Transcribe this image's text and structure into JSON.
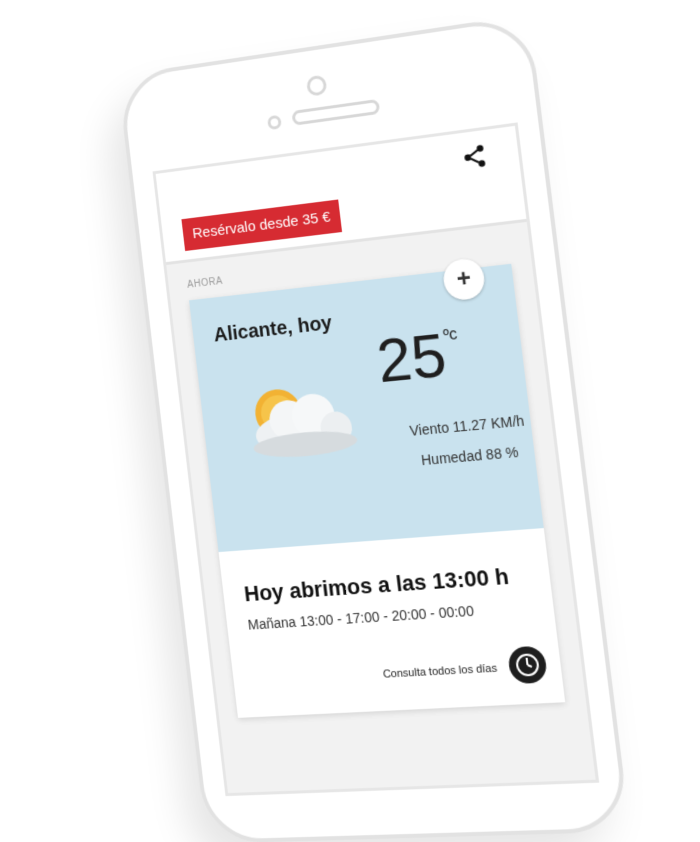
{
  "topbar": {
    "reserve_label": "Resérvalo desde 35 €",
    "share_icon": "share-icon"
  },
  "now_section": {
    "label": "AHORA"
  },
  "weather": {
    "city_day": "Alicante, hoy",
    "temperature": "25",
    "unit": "ºc",
    "wind": "Viento 11.27 KM/h",
    "humidity": "Humedad 88 %",
    "condition_icon": "partly-cloudy-icon",
    "add_icon": "plus-icon",
    "background_color": "#c9e2ee"
  },
  "opening_hours": {
    "today": "Hoy abrimos a las 13:00 h",
    "tomorrow": "Mañana 13:00 - 17:00 - 20:00 - 00:00",
    "all_days_label": "Consulta todos los días",
    "clock_icon": "clock-icon"
  },
  "colors": {
    "accent": "#d62b32"
  }
}
